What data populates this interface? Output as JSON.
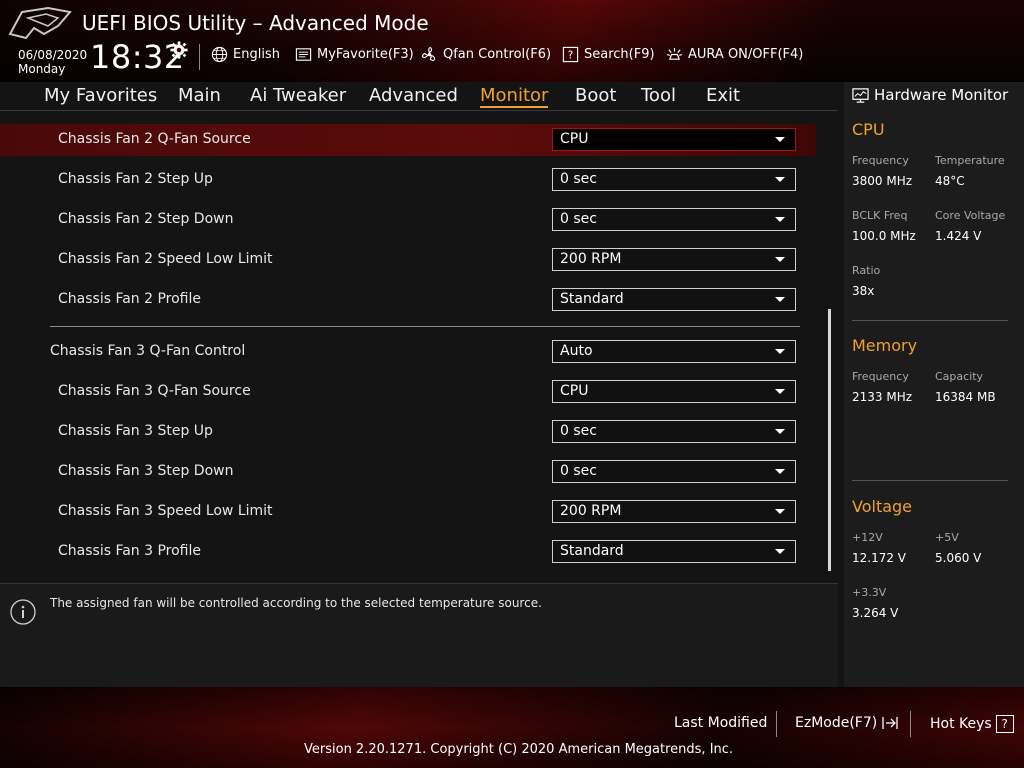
{
  "header": {
    "title": "UEFI BIOS Utility – Advanced Mode",
    "date": "06/08/2020",
    "day": "Monday",
    "time": "18:32",
    "tools": [
      {
        "label": "English",
        "icon": "globe-icon"
      },
      {
        "label": "MyFavorite(F3)",
        "icon": "favorite-list-icon"
      },
      {
        "label": "Qfan Control(F6)",
        "icon": "fan-icon"
      },
      {
        "label": "Search(F9)",
        "icon": "search-help-icon"
      },
      {
        "label": "AURA ON/OFF(F4)",
        "icon": "aura-light-icon"
      }
    ]
  },
  "menu": {
    "tabs": [
      "My Favorites",
      "Main",
      "Ai Tweaker",
      "Advanced",
      "Monitor",
      "Boot",
      "Tool",
      "Exit"
    ],
    "active": "Monitor"
  },
  "settings": [
    {
      "label": "Chassis Fan 2 Q-Fan Source",
      "value": "CPU"
    },
    {
      "label": "Chassis Fan 2 Step Up",
      "value": "0 sec"
    },
    {
      "label": "Chassis Fan 2 Step Down",
      "value": "0 sec"
    },
    {
      "label": "Chassis Fan 2 Speed Low Limit",
      "value": "200 RPM"
    },
    {
      "label": "Chassis Fan 2 Profile",
      "value": "Standard"
    },
    {
      "label": "Chassis Fan 3 Q-Fan Control",
      "value": "Auto"
    },
    {
      "label": "Chassis Fan 3 Q-Fan Source",
      "value": "CPU"
    },
    {
      "label": "Chassis Fan 3 Step Up",
      "value": "0 sec"
    },
    {
      "label": "Chassis Fan 3 Step Down",
      "value": "0 sec"
    },
    {
      "label": "Chassis Fan 3 Speed Low Limit",
      "value": "200 RPM"
    },
    {
      "label": "Chassis Fan 3 Profile",
      "value": "Standard"
    }
  ],
  "help": {
    "text": "The assigned fan will be controlled according to the selected temperature source."
  },
  "hardware_monitor": {
    "title": "Hardware Monitor",
    "cpu": {
      "title": "CPU",
      "frequency_label": "Frequency",
      "frequency": "3800 MHz",
      "temperature_label": "Temperature",
      "temperature": "48°C",
      "bclk_label": "BCLK Freq",
      "bclk": "100.0 MHz",
      "core_voltage_label": "Core Voltage",
      "core_voltage": "1.424 V",
      "ratio_label": "Ratio",
      "ratio": "38x"
    },
    "memory": {
      "title": "Memory",
      "frequency_label": "Frequency",
      "frequency": "2133 MHz",
      "capacity_label": "Capacity",
      "capacity": "16384 MB"
    },
    "voltage": {
      "title": "Voltage",
      "v12_label": "+12V",
      "v12": "12.172 V",
      "v5_label": "+5V",
      "v5": "5.060 V",
      "v33_label": "+3.3V",
      "v33": "3.264 V"
    }
  },
  "footer": {
    "last_modified": "Last Modified",
    "ezmode": "EzMode(F7)",
    "hotkeys": "Hot Keys",
    "hotkeys_key": "?",
    "copyright": "Version 2.20.1271. Copyright (C) 2020 American Megatrends, Inc."
  },
  "colors": {
    "accent": "#f0a030",
    "selected_row": "#5b0b0b",
    "brand_red": "#5a0a0a"
  }
}
